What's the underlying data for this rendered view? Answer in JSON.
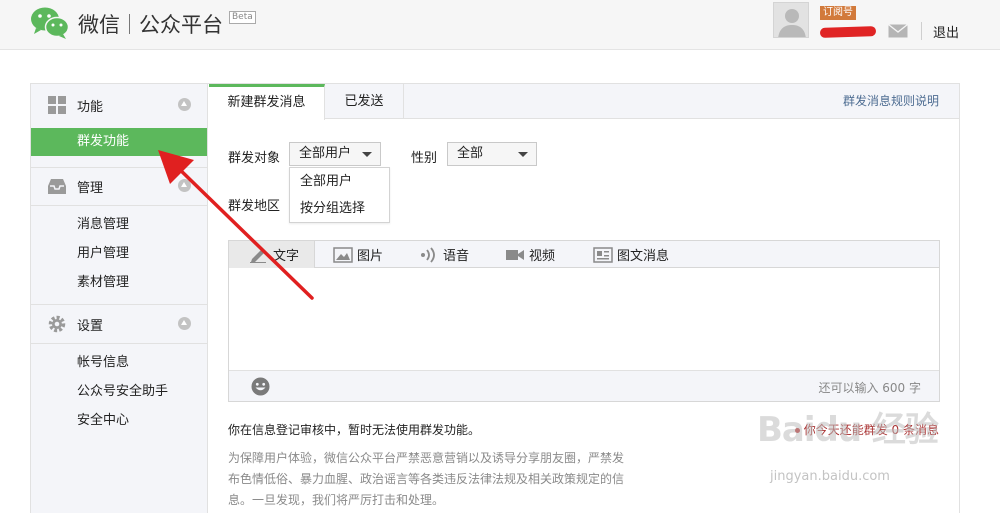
{
  "header": {
    "brand_wechat": "微信",
    "brand_platform": "公众平台",
    "beta": "Beta",
    "account_type": "订阅号",
    "logout": "退出"
  },
  "sidebar": {
    "function": {
      "label": "功能",
      "items": [
        "群发功能"
      ]
    },
    "manage": {
      "label": "管理",
      "items": [
        "消息管理",
        "用户管理",
        "素材管理"
      ]
    },
    "settings": {
      "label": "设置",
      "items": [
        "帐号信息",
        "公众号安全助手",
        "安全中心"
      ]
    }
  },
  "tabs": {
    "new_mass": "新建群发消息",
    "sent": "已发送",
    "rules_link": "群发消息规则说明"
  },
  "form": {
    "target_label": "群发对象",
    "target_value": "全部用户",
    "gender_label": "性别",
    "gender_value": "全部",
    "region_label": "群发地区",
    "dropdown_options": [
      "全部用户",
      "按分组选择"
    ]
  },
  "editor": {
    "tabs": [
      "文字",
      "图片",
      "语音",
      "视频",
      "图文消息"
    ],
    "counter": "还可以输入 600 字"
  },
  "notice": "你在信息登记审核中，暂时无法使用群发功能。",
  "quota": "你今天还能群发 0 条消息",
  "policy": "为保障用户体验，微信公众平台严禁恶意营销以及诱导分享朋友圈，严禁发布色情低俗、暴力血腥、政治谣言等各类违反法律法规及相关政策规定的信息。一旦发现，我们将严厉打击和处理。",
  "watermark": {
    "main": "Baidu 经验",
    "sub": "jingyan.baidu.com"
  },
  "colors": {
    "accent_green": "#5cb85c",
    "link_blue": "#4e6d92",
    "arrow_red": "#e02020"
  }
}
